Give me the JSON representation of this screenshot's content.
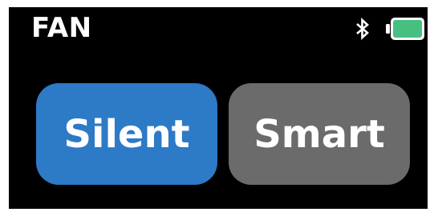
{
  "header": {
    "title": "FAN",
    "status_icons": [
      "bluetooth-icon",
      "battery-icon"
    ]
  },
  "battery": {
    "level": 1.0,
    "fill_color": "#45C080",
    "outline_color": "#FFFFFF"
  },
  "modes": [
    {
      "label": "Silent",
      "color": "#2D7AC7",
      "selected": true
    },
    {
      "label": "Smart",
      "color": "#6B6B6B",
      "selected": false
    }
  ]
}
